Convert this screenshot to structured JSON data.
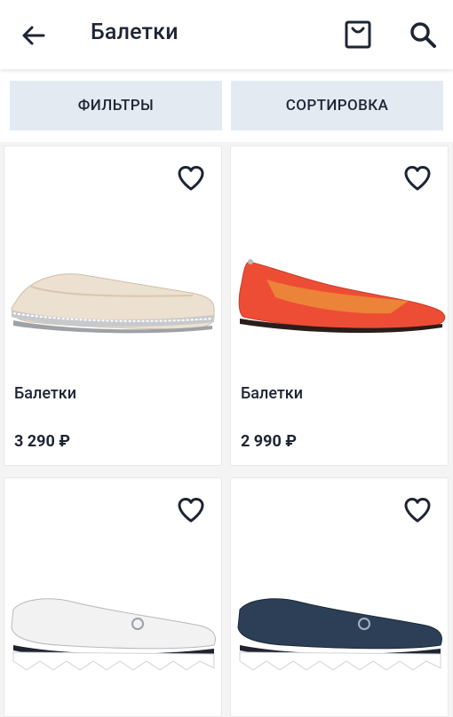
{
  "header": {
    "title": "Балетки",
    "back_icon": "arrow-left-icon",
    "bag_icon": "shopping-bag-icon",
    "search_icon": "search-icon"
  },
  "toolbar": {
    "filters_label": "ФИЛЬТРЫ",
    "sort_label": "СОРТИРОВКА"
  },
  "products": [
    {
      "name": "Балетки",
      "price": "3 290 ₽",
      "color": "beige-silver",
      "favorite": false
    },
    {
      "name": "Балетки",
      "price": "2 990 ₽",
      "color": "coral-red",
      "favorite": false
    },
    {
      "name": "",
      "price": "",
      "color": "white-perforated",
      "favorite": false
    },
    {
      "name": "",
      "price": "",
      "color": "navy-perforated",
      "favorite": false
    }
  ],
  "colors": {
    "accent_bg": "#e4eaf2",
    "text": "#1d2433"
  }
}
